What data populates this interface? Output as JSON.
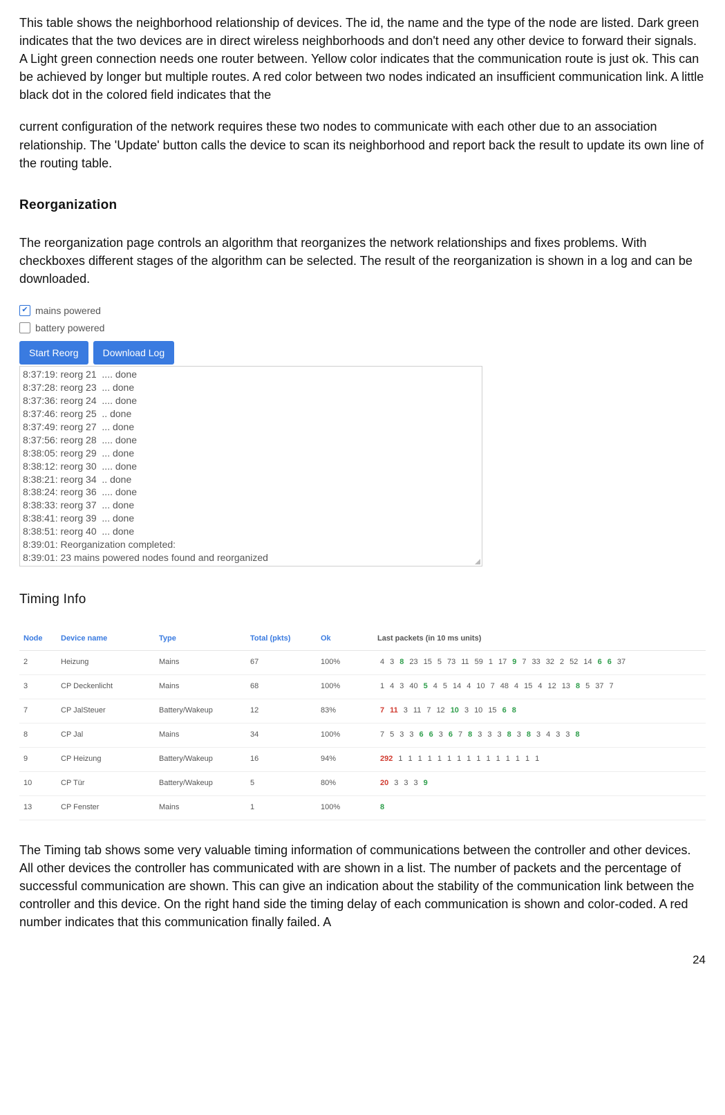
{
  "intro_para": "This table shows the neighborhood relationship of devices. The id, the name and the type of the node are listed. Dark green indicates that the two devices are in direct wireless neighborhoods and don't need any other device to forward their signals. A Light green connection needs one router between. Yellow color indicates that the communication route is just ok. This can be achieved by longer but multiple routes. A red color between two nodes indicated an insufficient communication link. A little black dot in the colored field indicates that the",
  "intro_para2": "current configuration of the network requires these two nodes to communicate with each other due to an association relationship. The 'Update' button calls the device to scan its neighborhood and report back the result to update its own line of the routing table.",
  "sections": {
    "reorg_title": "Reorganization",
    "reorg_para": "The reorganization page controls an algorithm that reorganizes the network relationships and fixes problems. With checkboxes different stages of the algorithm can be selected. The result of the reorganization is shown in a log and can be downloaded.",
    "timing_title": "Timing Info",
    "timing_para": "The Timing tab shows some very valuable timing information of communications between the controller and other devices. All other devices the controller has communicated with are shown in a list. The number of packets and the percentage of successful communication are shown. This can give an indication about the stability of the communication link between the controller and this device. On the right hand side the timing delay of each communication is shown and color-coded. A red number indicates that this communication finally failed. A"
  },
  "reorg_ui": {
    "cb_mains": "mains powered",
    "cb_battery": "battery powered",
    "btn_start": "Start Reorg",
    "btn_download": "Download Log",
    "log": [
      "8:37:19: reorg 21  .... done",
      "8:37:28: reorg 23  ... done",
      "8:37:36: reorg 24  .... done",
      "8:37:46: reorg 25  .. done",
      "8:37:49: reorg 27  ... done",
      "8:37:56: reorg 28  .... done",
      "8:38:05: reorg 29  ... done",
      "8:38:12: reorg 30  .... done",
      "8:38:21: reorg 34  .. done",
      "8:38:24: reorg 36  .... done",
      "8:38:33: reorg 37  ... done",
      "8:38:41: reorg 39  ... done",
      "8:38:51: reorg 40  ... done",
      "8:39:01: Reorganization completed:",
      "8:39:01: 23 mains powered nodes found and reorganized"
    ]
  },
  "timing_table": {
    "headers": {
      "node": "Node",
      "name": "Device name",
      "type": "Type",
      "total": "Total (pkts)",
      "ok": "Ok",
      "last": "Last packets (in 10 ms units)"
    },
    "rows": [
      {
        "node": "2",
        "name": "Heizung",
        "type": "Mains",
        "total": "67",
        "ok": "100%",
        "pk": [
          [
            "d",
            "4"
          ],
          [
            "d",
            "3"
          ],
          [
            "g",
            "8"
          ],
          [
            "d",
            "23"
          ],
          [
            "d",
            "15"
          ],
          [
            "d",
            "5"
          ],
          [
            "d",
            "73"
          ],
          [
            "d",
            "11"
          ],
          [
            "d",
            "59"
          ],
          [
            "d",
            "1"
          ],
          [
            "d",
            "17"
          ],
          [
            "g",
            "9"
          ],
          [
            "d",
            "7"
          ],
          [
            "d",
            "33"
          ],
          [
            "d",
            "32"
          ],
          [
            "d",
            "2"
          ],
          [
            "d",
            "52"
          ],
          [
            "d",
            "14"
          ],
          [
            "g",
            "6"
          ],
          [
            "g",
            "6"
          ],
          [
            "d",
            "37"
          ]
        ]
      },
      {
        "node": "3",
        "name": "CP Deckenlicht",
        "type": "Mains",
        "total": "68",
        "ok": "100%",
        "pk": [
          [
            "d",
            "1"
          ],
          [
            "d",
            "4"
          ],
          [
            "d",
            "3"
          ],
          [
            "d",
            "40"
          ],
          [
            "g",
            "5"
          ],
          [
            "d",
            "4"
          ],
          [
            "d",
            "5"
          ],
          [
            "d",
            "14"
          ],
          [
            "d",
            "4"
          ],
          [
            "d",
            "10"
          ],
          [
            "d",
            "7"
          ],
          [
            "d",
            "48"
          ],
          [
            "d",
            "4"
          ],
          [
            "d",
            "15"
          ],
          [
            "d",
            "4"
          ],
          [
            "d",
            "12"
          ],
          [
            "d",
            "13"
          ],
          [
            "g",
            "8"
          ],
          [
            "d",
            "5"
          ],
          [
            "d",
            "37"
          ],
          [
            "d",
            "7"
          ]
        ]
      },
      {
        "node": "7",
        "name": "CP JalSteuer",
        "type": "Battery/Wakeup",
        "total": "12",
        "ok": "83%",
        "pk": [
          [
            "r",
            "7"
          ],
          [
            "r",
            "11"
          ],
          [
            "d",
            "3"
          ],
          [
            "d",
            "11"
          ],
          [
            "d",
            "7"
          ],
          [
            "d",
            "12"
          ],
          [
            "g",
            "10"
          ],
          [
            "d",
            "3"
          ],
          [
            "d",
            "10"
          ],
          [
            "d",
            "15"
          ],
          [
            "g",
            "6"
          ],
          [
            "g",
            "8"
          ]
        ]
      },
      {
        "node": "8",
        "name": "CP Jal",
        "type": "Mains",
        "total": "34",
        "ok": "100%",
        "pk": [
          [
            "d",
            "7"
          ],
          [
            "d",
            "5"
          ],
          [
            "d",
            "3"
          ],
          [
            "d",
            "3"
          ],
          [
            "g",
            "6"
          ],
          [
            "g",
            "6"
          ],
          [
            "d",
            "3"
          ],
          [
            "g",
            "6"
          ],
          [
            "d",
            "7"
          ],
          [
            "g",
            "8"
          ],
          [
            "d",
            "3"
          ],
          [
            "d",
            "3"
          ],
          [
            "d",
            "3"
          ],
          [
            "g",
            "8"
          ],
          [
            "d",
            "3"
          ],
          [
            "g",
            "8"
          ],
          [
            "d",
            "3"
          ],
          [
            "d",
            "4"
          ],
          [
            "d",
            "3"
          ],
          [
            "d",
            "3"
          ],
          [
            "g",
            "8"
          ]
        ]
      },
      {
        "node": "9",
        "name": "CP Heizung",
        "type": "Battery/Wakeup",
        "total": "16",
        "ok": "94%",
        "pk": [
          [
            "r",
            "292"
          ],
          [
            "d",
            "1"
          ],
          [
            "d",
            "1"
          ],
          [
            "d",
            "1"
          ],
          [
            "d",
            "1"
          ],
          [
            "d",
            "1"
          ],
          [
            "d",
            "1"
          ],
          [
            "d",
            "1"
          ],
          [
            "d",
            "1"
          ],
          [
            "d",
            "1"
          ],
          [
            "d",
            "1"
          ],
          [
            "d",
            "1"
          ],
          [
            "d",
            "1"
          ],
          [
            "d",
            "1"
          ],
          [
            "d",
            "1"
          ],
          [
            "d",
            "1"
          ]
        ]
      },
      {
        "node": "10",
        "name": "CP Tür",
        "type": "Battery/Wakeup",
        "total": "5",
        "ok": "80%",
        "pk": [
          [
            "r",
            "20"
          ],
          [
            "d",
            "3"
          ],
          [
            "d",
            "3"
          ],
          [
            "d",
            "3"
          ],
          [
            "g",
            "9"
          ]
        ]
      },
      {
        "node": "13",
        "name": "CP Fenster",
        "type": "Mains",
        "total": "1",
        "ok": "100%",
        "pk": [
          [
            "g",
            "8"
          ]
        ]
      }
    ]
  },
  "page_number": "24"
}
